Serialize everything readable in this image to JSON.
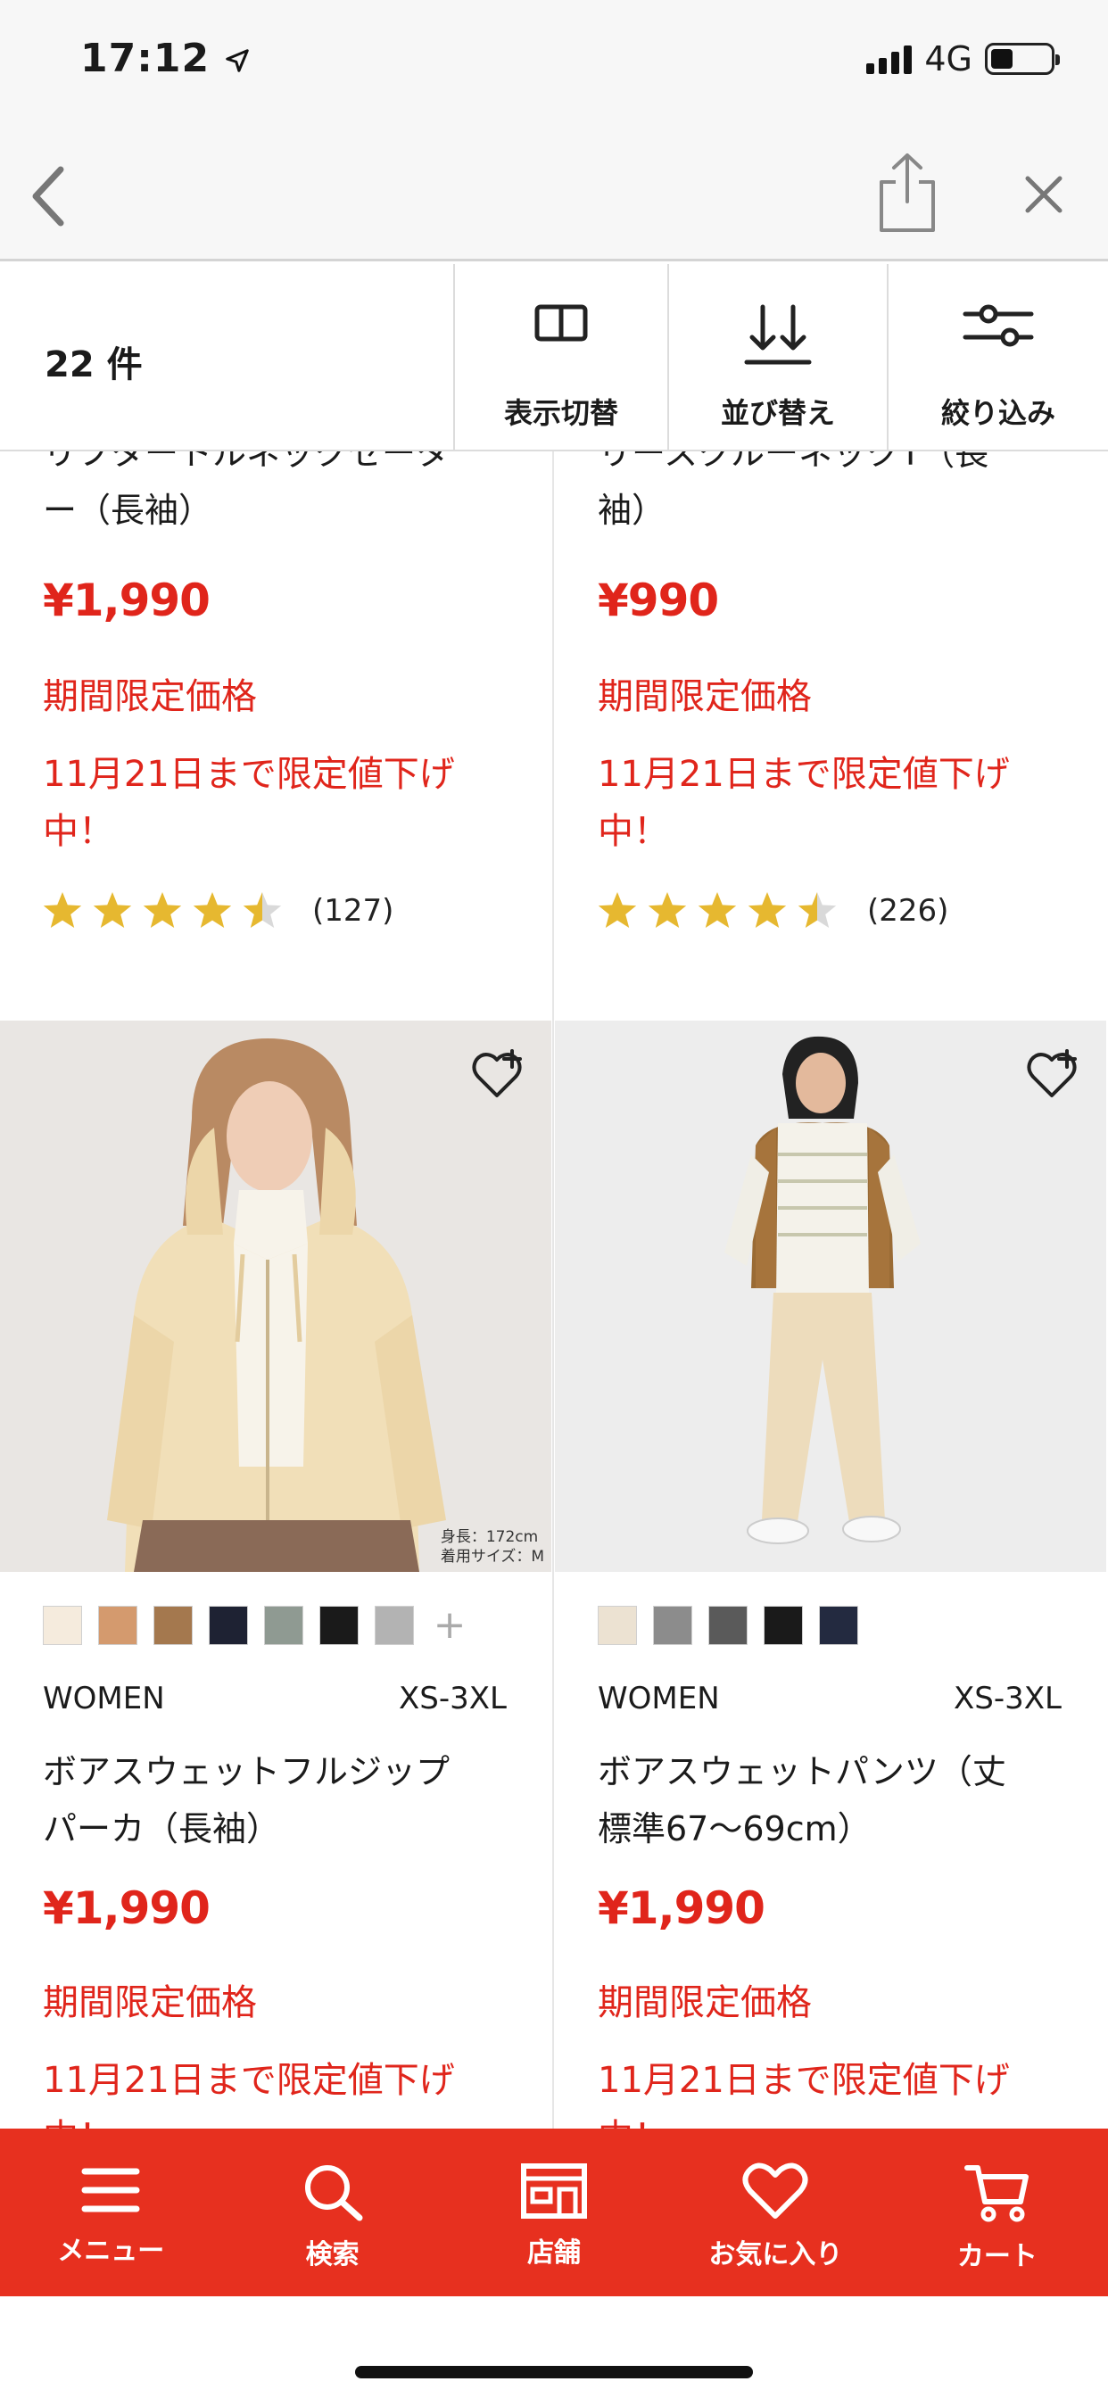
{
  "status_bar": {
    "time": "17:12",
    "network": "4G"
  },
  "filter_bar": {
    "count": "22 件",
    "buttons": [
      "表示切替",
      "並び替え",
      "絞り込み"
    ]
  },
  "products": [
    {
      "name": "リフタートルネックセーター（長袖）",
      "name_lines": [
        "リフタートルネックセータ",
        "ー（長袖）"
      ],
      "price": "¥1,990",
      "promo1": "期間限定価格",
      "promo2_lines": [
        "11月21日まで限定値下げ",
        "中！"
      ],
      "rating": 4.5,
      "review_count": "(127)"
    },
    {
      "name": "リースクルーネックT（長袖）",
      "name_lines": [
        "リースクルーネックT（長",
        "袖）"
      ],
      "price": "¥990",
      "promo1": "期間限定価格",
      "promo2_lines": [
        "11月21日まで限定値下げ",
        "中！"
      ],
      "rating": 4.5,
      "review_count": "(226)"
    },
    {
      "size_note_lines": [
        "身長：172cm",
        "着用サイズ：M"
      ],
      "swatch_colors": [
        "#f5ebdd",
        "#d49a6e",
        "#a4784e",
        "#1e2233",
        "#8f9a92",
        "#1a1a1a",
        "#b3b3b3"
      ],
      "more_colors": "+",
      "gender": "WOMEN",
      "sizes": "XS-3XL",
      "name_lines": [
        "ボアスウェットフルジップ",
        "パーカ（長袖）"
      ],
      "price": "¥1,990",
      "promo1": "期間限定価格",
      "promo2_lines": [
        "11月21日まで限定値下げ",
        "中！"
      ]
    },
    {
      "swatch_colors": [
        "#ece2d2",
        "#8c8c8c",
        "#5a5a5a",
        "#1a1a1a",
        "#232a40"
      ],
      "gender": "WOMEN",
      "sizes": "XS-3XL",
      "name_lines": [
        "ボアスウェットパンツ（丈",
        "標準67〜69cm）"
      ],
      "price": "¥1,990",
      "promo1": "期間限定価格",
      "promo2_lines": [
        "11月21日まで限定値下げ",
        "中！"
      ]
    }
  ],
  "tab_bar": {
    "items": [
      {
        "label": "メニュー",
        "icon": "menu-icon"
      },
      {
        "label": "検索",
        "icon": "search-icon"
      },
      {
        "label": "店舗",
        "icon": "store-icon"
      },
      {
        "label": "お気に入り",
        "icon": "heart-icon"
      },
      {
        "label": "カート",
        "icon": "cart-icon"
      }
    ]
  },
  "colors": {
    "brand_red": "#e7301f",
    "price_red": "#e0251b",
    "star": "#e6b830"
  }
}
